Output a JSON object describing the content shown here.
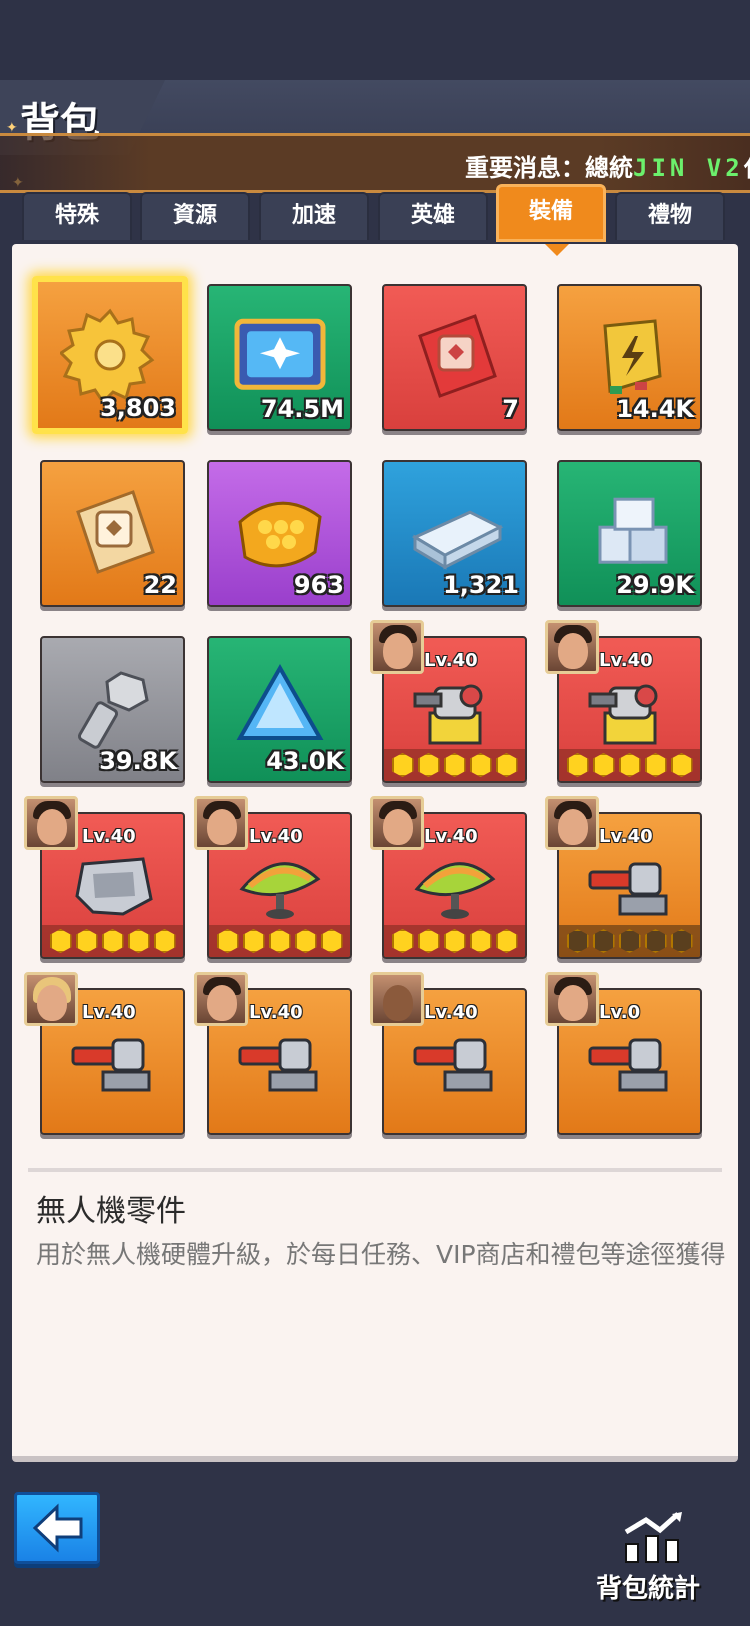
{
  "header": {
    "title": "背包",
    "news_prefix": "重要消息：總統",
    "news_name": "JIN V2",
    "news_suffix": "仕"
  },
  "tabs": [
    {
      "label": "特殊",
      "active": false
    },
    {
      "label": "資源",
      "active": false
    },
    {
      "label": "加速",
      "active": false
    },
    {
      "label": "英雄",
      "active": false
    },
    {
      "label": "裝備",
      "active": true
    },
    {
      "label": "禮物",
      "active": false
    }
  ],
  "items": [
    {
      "icon": "gear-icon",
      "bg": "orange",
      "qty": "3,803",
      "selected": true
    },
    {
      "icon": "drone-chip-icon",
      "bg": "green",
      "qty": "74.5M"
    },
    {
      "icon": "blueprint-red-icon",
      "bg": "red",
      "qty": "7"
    },
    {
      "icon": "battery-icon",
      "bg": "orange",
      "qty": "14.4K"
    },
    {
      "icon": "blueprint-orange-icon",
      "bg": "orange",
      "qty": "22"
    },
    {
      "icon": "honeycomb-icon",
      "bg": "purple",
      "qty": "963"
    },
    {
      "icon": "metal-ingot-icon",
      "bg": "blue",
      "qty": "1,321"
    },
    {
      "icon": "silver-blocks-icon",
      "bg": "green",
      "qty": "29.9K"
    },
    {
      "icon": "bolt-icon",
      "bg": "gray",
      "qty": "39.8K"
    },
    {
      "icon": "crystal-icon",
      "bg": "green",
      "qty": "43.0K"
    },
    {
      "icon": "turret-icon",
      "bg": "red",
      "lv": "Lv.40",
      "stars": 5
    },
    {
      "icon": "turret-icon",
      "bg": "red",
      "lv": "Lv.40",
      "stars": 5
    },
    {
      "icon": "armor-chest-icon",
      "bg": "red",
      "lv": "Lv.40",
      "stars": 5
    },
    {
      "icon": "radar-shield-icon",
      "bg": "red",
      "lv": "Lv.40",
      "stars": 5
    },
    {
      "icon": "radar-shield-icon",
      "bg": "red",
      "lv": "Lv.40",
      "stars": 5
    },
    {
      "icon": "cannon-icon",
      "bg": "orange",
      "lv": "Lv.40",
      "stars": 0
    },
    {
      "icon": "cannon-icon",
      "bg": "orange",
      "lv": "Lv.40"
    },
    {
      "icon": "cannon-icon",
      "bg": "orange",
      "lv": "Lv.40"
    },
    {
      "icon": "cannon-icon",
      "bg": "orange",
      "lv": "Lv.40"
    },
    {
      "icon": "cannon-icon",
      "bg": "orange",
      "lv": "Lv.0"
    }
  ],
  "description": {
    "title": "無人機零件",
    "body": "用於無人機硬體升級，於每日任務、VIP商店和禮包等途徑獲得"
  },
  "footer": {
    "back_icon": "arrow-left-icon",
    "stats_label": "背包統計",
    "stats_icon": "chart-trend-icon"
  }
}
